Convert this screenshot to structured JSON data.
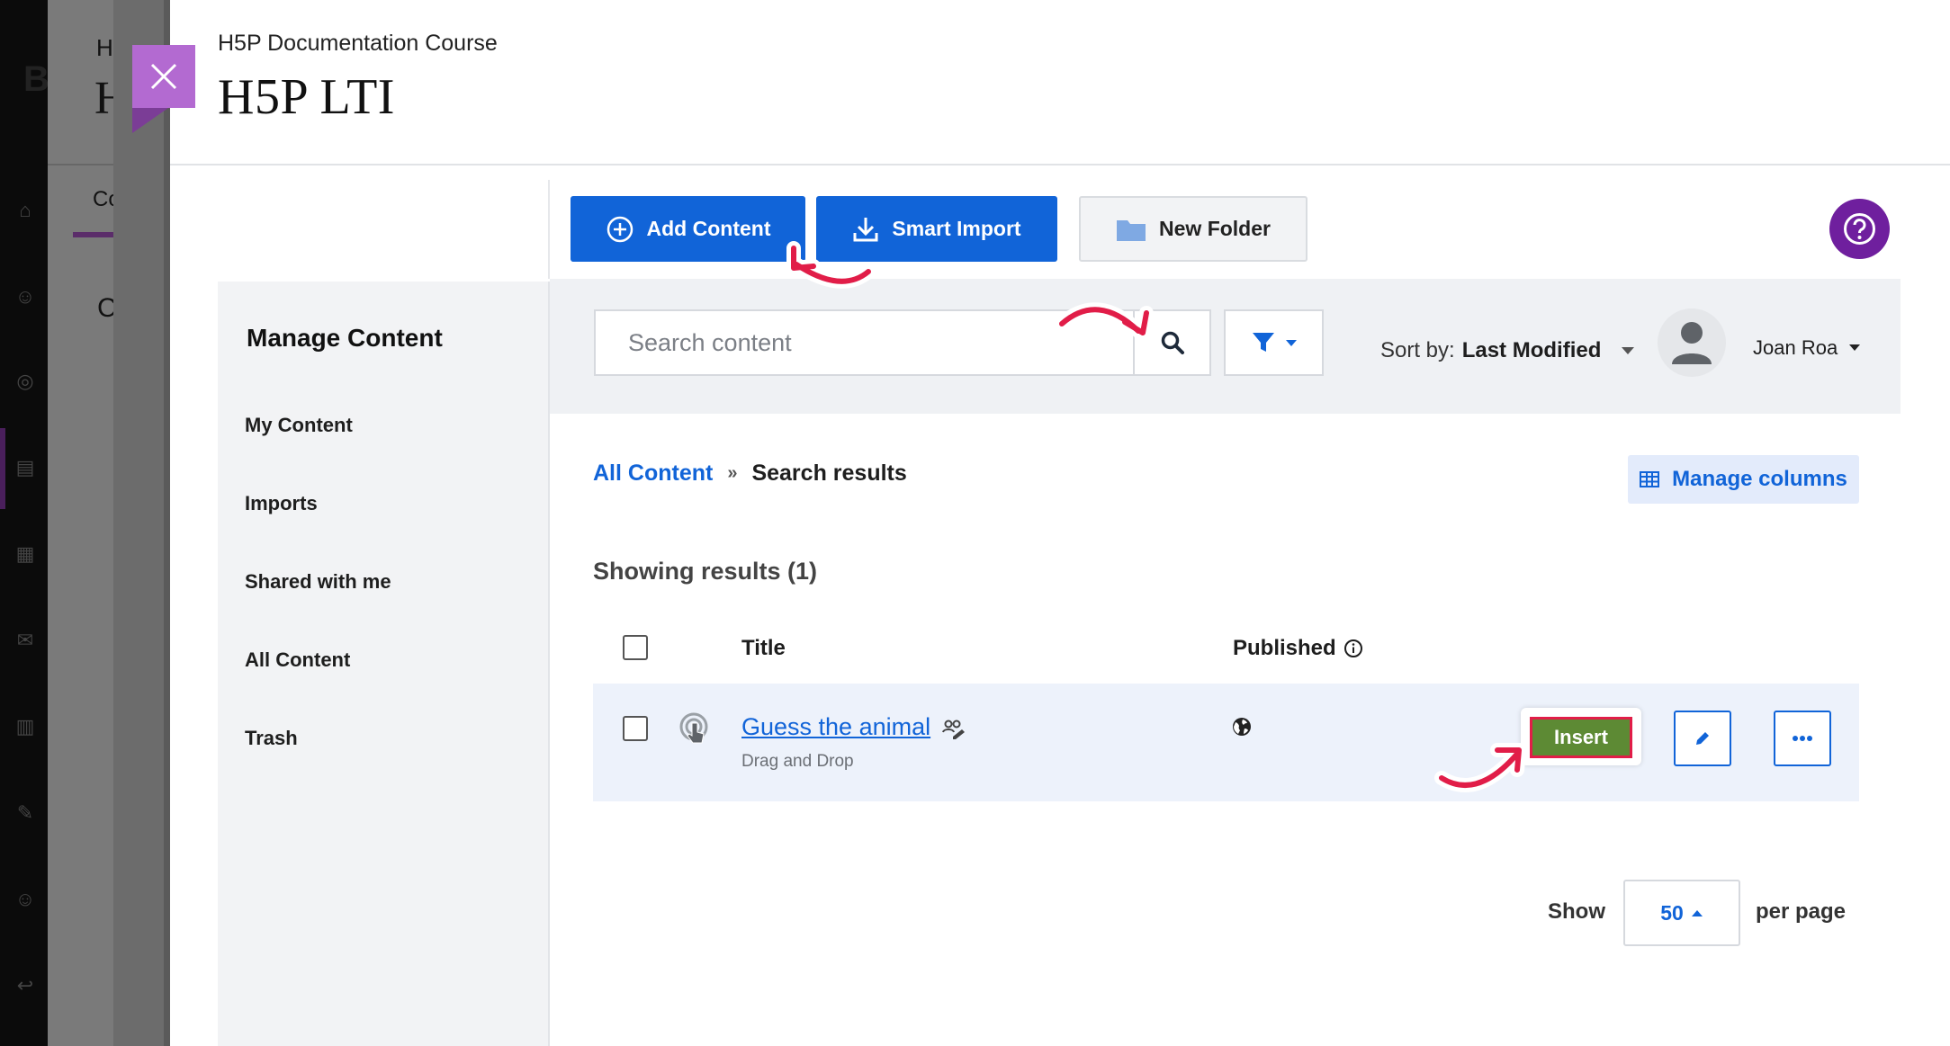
{
  "colors": {
    "primary": "#1164d8",
    "help": "#6f1f9e",
    "close_tab": "#b36ad1",
    "insert": "#5d8a34",
    "highlight": "#e11d48"
  },
  "background_fragments": {
    "a": "H",
    "b": "H",
    "c": "Co",
    "d": "C",
    "e": "B"
  },
  "header": {
    "course": "H5P Documentation Course",
    "title": "H5P LTI",
    "close_icon": "close-icon"
  },
  "toolbar": {
    "add_content": "Add Content",
    "smart_import": "Smart Import",
    "new_folder": "New Folder",
    "help_icon": "question-icon"
  },
  "sidebar": {
    "title": "Manage Content",
    "items": [
      {
        "label": "My Content"
      },
      {
        "label": "Imports"
      },
      {
        "label": "Shared with me"
      },
      {
        "label": "All Content"
      },
      {
        "label": "Trash"
      }
    ]
  },
  "search": {
    "placeholder": "Search content",
    "sort_label": "Sort by:",
    "sort_value": "Last Modified",
    "user_name": "Joan Roa"
  },
  "breadcrumb": {
    "root": "All Content",
    "separator": "»",
    "current": "Search results"
  },
  "manage_columns": "Manage columns",
  "results_text": "Showing results (1)",
  "table": {
    "columns": [
      "Title",
      "Published"
    ],
    "rows": [
      {
        "title": "Guess the animal",
        "type": "Drag and Drop",
        "published": "public",
        "insert_label": "Insert"
      }
    ]
  },
  "pagination": {
    "show_label": "Show",
    "per_page_value": "50",
    "per_page_label": "per page"
  }
}
